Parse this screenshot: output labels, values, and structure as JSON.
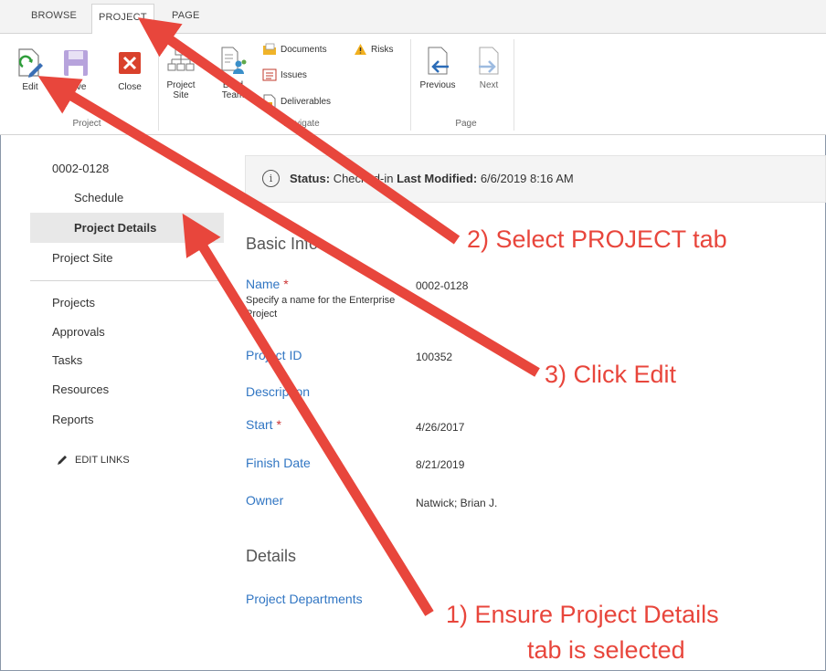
{
  "ribbon": {
    "tabs": [
      "BROWSE",
      "PROJECT",
      "PAGE"
    ],
    "project_group": {
      "label": "Project",
      "buttons": {
        "edit": "Edit",
        "save": "Save",
        "close": "Close"
      }
    },
    "navigate_group": {
      "label": "Navigate",
      "buttons": {
        "project_site": "Project Site",
        "build_team": "Build Team",
        "documents": "Documents",
        "risks": "Risks",
        "issues": "Issues",
        "deliverables": "Deliverables"
      }
    },
    "page_group": {
      "label": "Page",
      "buttons": {
        "previous": "Previous",
        "next": "Next"
      }
    }
  },
  "nav": {
    "project_code": "0002-0128",
    "schedule": "Schedule",
    "project_details": "Project Details",
    "project_site": "Project Site",
    "links": [
      "Projects",
      "Approvals",
      "Tasks",
      "Resources",
      "Reports"
    ],
    "edit_links": "EDIT LINKS"
  },
  "status": {
    "status_label": "Status:",
    "status_value": "Checked-in",
    "modified_label": "Last Modified:",
    "modified_value": "6/6/2019 8:16 AM"
  },
  "form": {
    "basic_info_title": "Basic Info",
    "name_label": "Name",
    "required_marker": "*",
    "name_desc": "Specify a name for the Enterprise Project",
    "name_value": "0002-0128",
    "project_id_label": "Project ID",
    "project_id_value": "100352",
    "description_label": "Description",
    "start_label": "Start",
    "start_value": "4/26/2017",
    "finish_label": "Finish Date",
    "finish_value": "8/21/2019",
    "owner_label": "Owner",
    "owner_value": "Natwick; Brian J.",
    "details_title": "Details",
    "departments_label": "Project Departments"
  },
  "callouts": {
    "step2": "2) Select PROJECT tab",
    "step3": "3) Click Edit",
    "step1_line1": "1) Ensure Project Details",
    "step1_line2": "tab is selected"
  },
  "colors": {
    "accent": "#3176c3",
    "callout": "#e8463c",
    "close_icon": "#d9412c",
    "save_icon": "#9b80c8"
  }
}
